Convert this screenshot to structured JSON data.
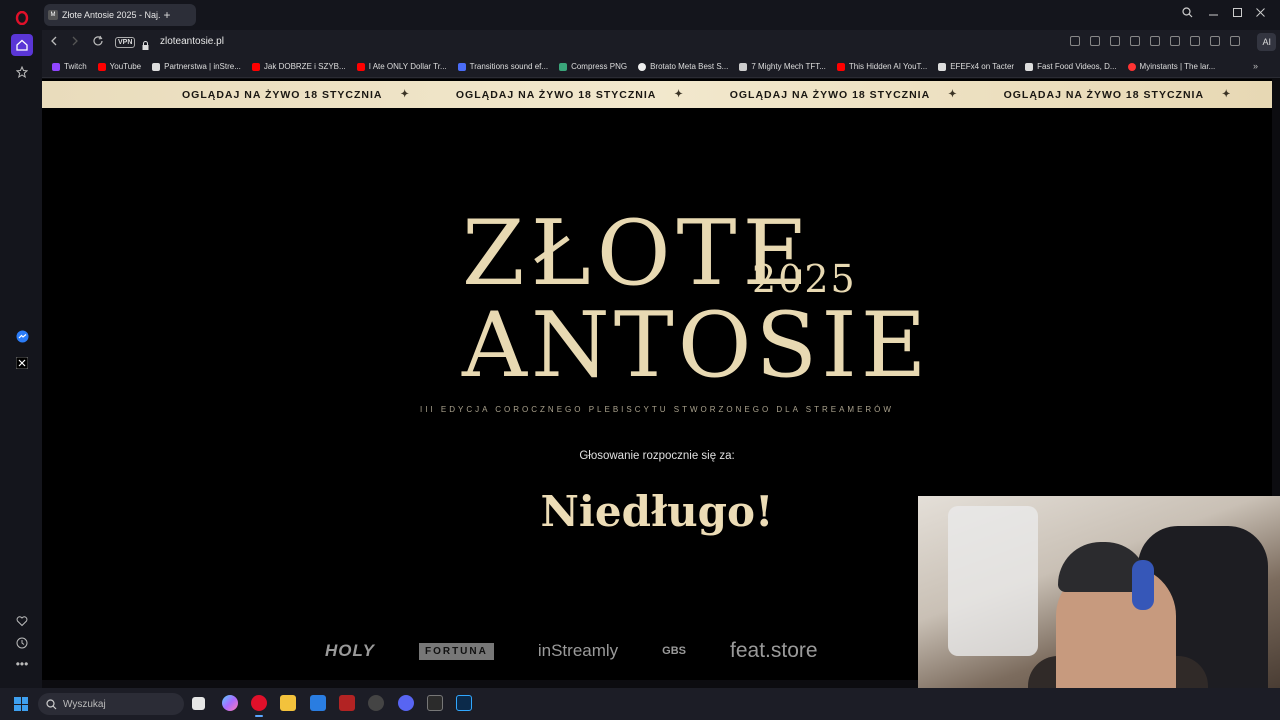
{
  "browser": {
    "tab_title": "Złote Antosie 2025 - Naj...",
    "new_tab_label": "+",
    "url": "zloteantosie.pl",
    "vpn_label": "VPN",
    "ai_label": "AI"
  },
  "bookmarks": [
    {
      "label": "Twitch",
      "color": "#9146ff"
    },
    {
      "label": "YouTube",
      "color": "#ff0000"
    },
    {
      "label": "Partnerstwa | inStre...",
      "color": "#dddddd"
    },
    {
      "label": "Jak DOBRZE i SZYB...",
      "color": "#ff0000"
    },
    {
      "label": "I Ate ONLY Dollar Tr...",
      "color": "#ff0000"
    },
    {
      "label": "Transitions sound ef...",
      "color": "#4a6cf7"
    },
    {
      "label": "Compress PNG",
      "color": "#3aa57a"
    },
    {
      "label": "Brotato Meta Best S...",
      "color": "#eeeeee"
    },
    {
      "label": "7 Mighty Mech TFT...",
      "color": "#cccccc"
    },
    {
      "label": "This Hidden AI YouT...",
      "color": "#ff0000"
    },
    {
      "label": "EFEFx4 on Tacter",
      "color": "#dddddd"
    },
    {
      "label": "Fast Food Videos, D...",
      "color": "#dddddd"
    },
    {
      "label": "Myinstants | The lar...",
      "color": "#ff3333"
    }
  ],
  "page": {
    "marquee": [
      "OGLĄDAJ NA ŻYWO 18 STYCZNIA",
      "OGLĄDAJ NA ŻYWO 18 STYCZNIA",
      "OGLĄDAJ NA ŻYWO 18 STYCZNIA",
      "OGLĄDAJ NA ŻYWO 18 STYCZNIA"
    ],
    "logo_line1": "ZŁOTE",
    "logo_year": "2025",
    "logo_line2": "ANTOSIE",
    "subtitle": "III EDYCJA COROCZNEGO PLEBISCYTU STWORZONEGO DLA STREAMERÓW",
    "vote_label": "Głosowanie rozpocznie się za:",
    "countdown": "Niedługo!",
    "sponsors": [
      "HOLY",
      "FORTUNA",
      "inStreamly",
      "GBS",
      "feat.store"
    ]
  },
  "taskbar": {
    "search_placeholder": "Wyszukaj"
  },
  "colors": {
    "gold": "#e8d9b2",
    "marquee_bg": "#efe4c6",
    "accent": "#5ba7ff"
  }
}
